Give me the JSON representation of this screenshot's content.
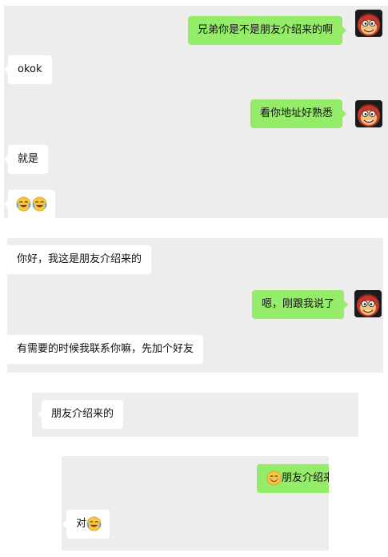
{
  "screenshot_1": {
    "messages": [
      {
        "side": "out",
        "text": "兄弟你是不是朋友介绍来的啊"
      },
      {
        "side": "in",
        "text": "okok"
      },
      {
        "side": "out",
        "text": "看你地址好熟悉"
      },
      {
        "side": "in",
        "text": "就是"
      },
      {
        "side": "in",
        "emojis": [
          "laugh-cry-emoji",
          "laugh-cry-emoji"
        ]
      }
    ]
  },
  "screenshot_2": {
    "messages": [
      {
        "side": "in",
        "text": "你好，我这是朋友介绍来的"
      },
      {
        "side": "out",
        "text": "嗯，刚跟我说了"
      },
      {
        "side": "in",
        "text": "有需要的时候我联系你嘛，先加个好友"
      }
    ]
  },
  "screenshot_3": {
    "messages": [
      {
        "side": "in",
        "text": "朋友介绍来的"
      }
    ]
  },
  "screenshot_4": {
    "messages": [
      {
        "side": "out",
        "emoji": "smile-emoji",
        "text": "朋友介绍来"
      },
      {
        "side": "in",
        "text": "对",
        "emoji": "laugh-cry-emoji"
      }
    ]
  },
  "colors": {
    "chat_background": "#ededed",
    "incoming_bubble": "#ffffff",
    "outgoing_bubble": "#95ec69"
  }
}
